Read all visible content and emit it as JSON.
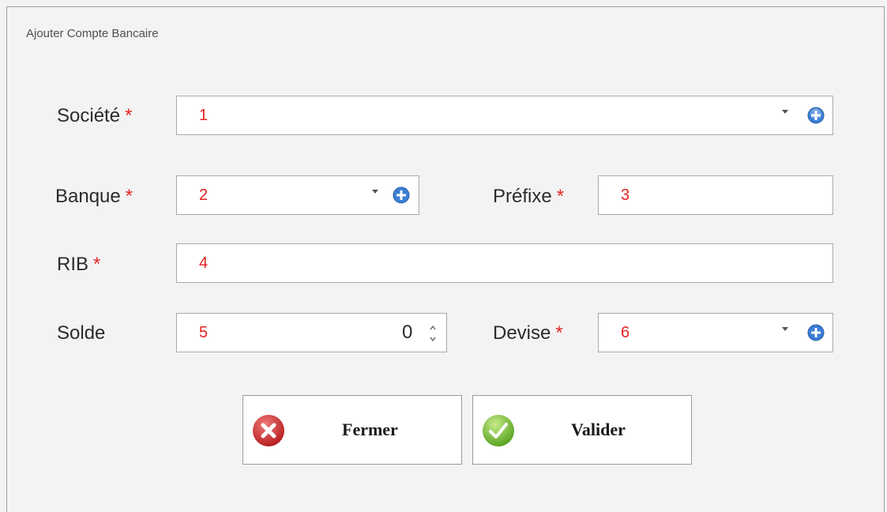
{
  "window": {
    "title": "Ajouter Compte Bancaire"
  },
  "required_marker": "*",
  "fields": {
    "societe": {
      "label": "Société",
      "value": "1",
      "required": true
    },
    "banque": {
      "label": "Banque",
      "value": "2",
      "required": true
    },
    "prefixe": {
      "label": "Préfixe",
      "value": "3",
      "required": true
    },
    "rib": {
      "label": "RIB",
      "value": "4",
      "required": true
    },
    "solde": {
      "label": "Solde",
      "value": "5",
      "spin_value": "0",
      "required": false
    },
    "devise": {
      "label": "Devise",
      "value": "6",
      "required": true
    }
  },
  "buttons": {
    "fermer": "Fermer",
    "valider": "Valider"
  },
  "icons": {
    "add": "add-circle-icon",
    "close": "close-circle-icon",
    "check": "checkmark-circle-icon"
  },
  "colors": {
    "required": "#e32626",
    "value_text": "#e52020",
    "add_icon": "#3b7fd4",
    "close_icon": "#d32f2f",
    "check_icon": "#6cbf2a"
  }
}
